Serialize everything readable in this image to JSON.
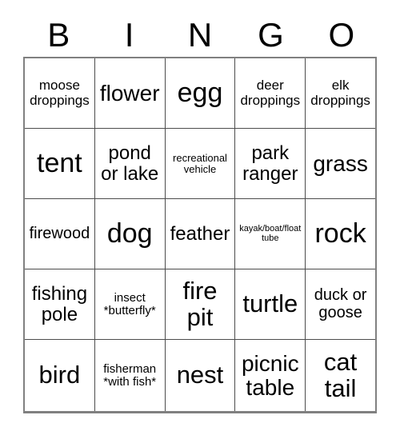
{
  "card": {
    "header": {
      "letters": [
        "B",
        "I",
        "N",
        "G",
        "O"
      ]
    },
    "rows": [
      {
        "cells": [
          {
            "text": "moose\ndroppings",
            "size": "xs"
          },
          {
            "text": "flower",
            "size": "lg"
          },
          {
            "text": "egg",
            "size": "xxl"
          },
          {
            "text": "deer\ndroppings",
            "size": "xs"
          },
          {
            "text": "elk\ndroppings",
            "size": "xs"
          }
        ]
      },
      {
        "cells": [
          {
            "text": "tent",
            "size": "xxl"
          },
          {
            "text": "pond\nor lake",
            "size": "md"
          },
          {
            "text": "recreational\nvehicle",
            "size": "tiny"
          },
          {
            "text": "park\nranger",
            "size": "md"
          },
          {
            "text": "grass",
            "size": "lg"
          }
        ]
      },
      {
        "cells": [
          {
            "text": "firewood",
            "size": "sm"
          },
          {
            "text": "dog",
            "size": "xxl"
          },
          {
            "text": "feather",
            "size": "md"
          },
          {
            "text": "kayak/boat/float\ntube",
            "size": "micro"
          },
          {
            "text": "rock",
            "size": "xxl"
          }
        ]
      },
      {
        "cells": [
          {
            "text": "fishing\npole",
            "size": "md"
          },
          {
            "text": "insect\n*butterfly*",
            "size": "xxs"
          },
          {
            "text": "fire\npit",
            "size": "xl"
          },
          {
            "text": "turtle",
            "size": "xl"
          },
          {
            "text": "duck or\ngoose",
            "size": "sm"
          }
        ]
      },
      {
        "cells": [
          {
            "text": "bird",
            "size": "xl"
          },
          {
            "text": "fisherman\n*with fish*",
            "size": "xxs"
          },
          {
            "text": "nest",
            "size": "xl"
          },
          {
            "text": "picnic\ntable",
            "size": "lg"
          },
          {
            "text": "cat\ntail",
            "size": "xl"
          }
        ]
      }
    ]
  }
}
